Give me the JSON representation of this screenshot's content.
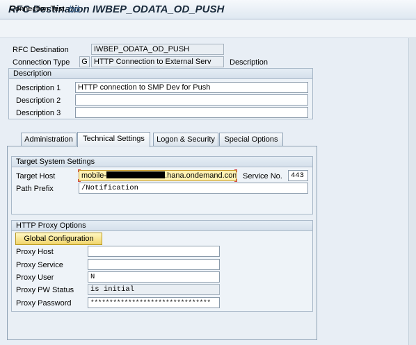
{
  "title": "RFC Destination IWBEP_ODATA_OD_PUSH",
  "toolbar": {
    "connection_test": "Connection Test"
  },
  "header": {
    "rfc_destination_label": "RFC Destination",
    "rfc_destination_value": "IWBEP_ODATA_OD_PUSH",
    "connection_type_label": "Connection Type",
    "connection_type_code": "G",
    "connection_type_value": "HTTP Connection to External Serv",
    "description_link": "Description"
  },
  "description": {
    "header": "Description",
    "d1_label": "Description 1",
    "d1_value": "HTTP connection to SMP Dev for Push",
    "d2_label": "Description 2",
    "d2_value": "",
    "d3_label": "Description 3",
    "d3_value": ""
  },
  "tabs": [
    {
      "label": "Administration"
    },
    {
      "label": "Technical Settings"
    },
    {
      "label": "Logon & Security"
    },
    {
      "label": "Special Options"
    }
  ],
  "target_system": {
    "header": "Target System Settings",
    "host_label": "Target Host",
    "host_prefix": "mobile-",
    "host_suffix": ".hana.ondemand.com",
    "service_label": "Service No.",
    "service_value": "443",
    "path_label": "Path Prefix",
    "path_value": "/Notification"
  },
  "proxy": {
    "header": "HTTP Proxy Options",
    "global_config_button": "Global Configuration",
    "host_label": "Proxy Host",
    "host_value": "",
    "service_label": "Proxy Service",
    "service_value": "",
    "user_label": "Proxy User",
    "user_value": "N",
    "pw_status_label": "Proxy PW Status",
    "pw_status_value": "is initial",
    "password_label": "Proxy Password",
    "password_value": "********************************"
  },
  "colors": {
    "title_text": "#1a2b3c",
    "highlight_field": "#fff2b3",
    "button_yellow": "#f1d56b",
    "background": "#e8eef5"
  }
}
